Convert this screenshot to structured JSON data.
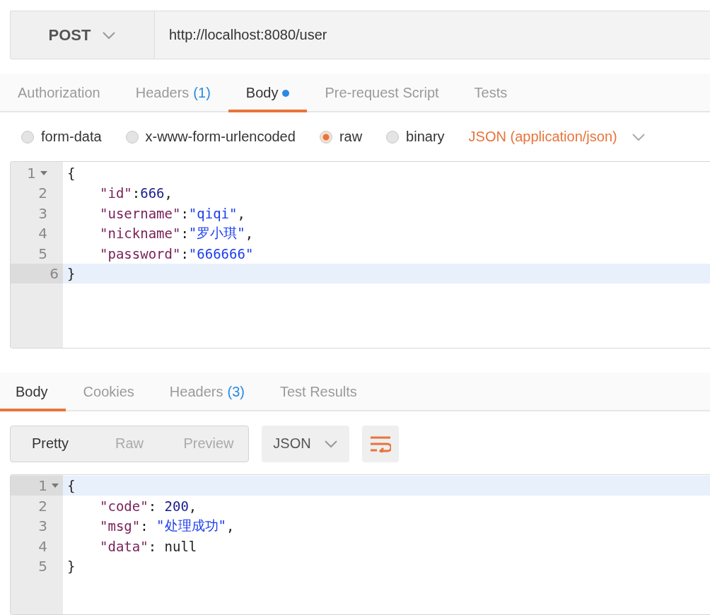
{
  "request": {
    "method": "POST",
    "url": "http://localhost:8080/user"
  },
  "request_tabs": [
    {
      "label": "Authorization",
      "selected": false,
      "dot": false
    },
    {
      "label": "Headers",
      "count": "(1)",
      "selected": false,
      "dot": false
    },
    {
      "label": "Body",
      "selected": true,
      "dot": true
    },
    {
      "label": "Pre-request Script",
      "selected": false,
      "dot": false
    },
    {
      "label": "Tests",
      "selected": false,
      "dot": false
    }
  ],
  "body_types": [
    {
      "label": "form-data",
      "selected": false
    },
    {
      "label": "x-www-form-urlencoded",
      "selected": false
    },
    {
      "label": "raw",
      "selected": true
    },
    {
      "label": "binary",
      "selected": false
    }
  ],
  "content_type": "JSON (application/json)",
  "request_body": [
    {
      "number": "1",
      "fold": true,
      "active": false,
      "indented": false,
      "tokens": [
        {
          "kind": "punct",
          "text": "{"
        }
      ]
    },
    {
      "number": "2",
      "fold": false,
      "active": false,
      "indented": true,
      "tokens": [
        {
          "kind": "key",
          "text": "\"id\""
        },
        {
          "kind": "punct",
          "text": ":"
        },
        {
          "kind": "num",
          "text": "666"
        },
        {
          "kind": "punct",
          "text": ","
        }
      ]
    },
    {
      "number": "3",
      "fold": false,
      "active": false,
      "indented": true,
      "tokens": [
        {
          "kind": "key",
          "text": "\"username\""
        },
        {
          "kind": "punct",
          "text": ":"
        },
        {
          "kind": "str",
          "text": "\"qiqi\""
        },
        {
          "kind": "punct",
          "text": ","
        }
      ]
    },
    {
      "number": "4",
      "fold": false,
      "active": false,
      "indented": true,
      "tokens": [
        {
          "kind": "key",
          "text": "\"nickname\""
        },
        {
          "kind": "punct",
          "text": ":"
        },
        {
          "kind": "str",
          "text": "\"罗小琪\""
        },
        {
          "kind": "punct",
          "text": ","
        }
      ]
    },
    {
      "number": "5",
      "fold": false,
      "active": false,
      "indented": true,
      "tokens": [
        {
          "kind": "key",
          "text": "\"password\""
        },
        {
          "kind": "punct",
          "text": ":"
        },
        {
          "kind": "str",
          "text": "\"666666\""
        }
      ]
    },
    {
      "number": "6",
      "fold": false,
      "active": true,
      "indented": false,
      "tokens": [
        {
          "kind": "punct",
          "text": "}"
        }
      ]
    }
  ],
  "response_tabs": [
    {
      "label": "Body",
      "selected": true
    },
    {
      "label": "Cookies",
      "selected": false
    },
    {
      "label": "Headers",
      "count": "(3)",
      "selected": false
    },
    {
      "label": "Test Results",
      "selected": false
    }
  ],
  "view_modes": [
    {
      "label": "Pretty",
      "selected": true
    },
    {
      "label": "Raw",
      "selected": false
    },
    {
      "label": "Preview",
      "selected": false
    }
  ],
  "format": "JSON",
  "response_body": [
    {
      "number": "1",
      "fold": true,
      "active": true,
      "indented": false,
      "tokens": [
        {
          "kind": "punct",
          "text": "{"
        }
      ]
    },
    {
      "number": "2",
      "fold": false,
      "active": false,
      "indented": true,
      "tokens": [
        {
          "kind": "key",
          "text": "\"code\""
        },
        {
          "kind": "punct",
          "text": ": "
        },
        {
          "kind": "num",
          "text": "200"
        },
        {
          "kind": "punct",
          "text": ","
        }
      ]
    },
    {
      "number": "3",
      "fold": false,
      "active": false,
      "indented": true,
      "tokens": [
        {
          "kind": "key",
          "text": "\"msg\""
        },
        {
          "kind": "punct",
          "text": ": "
        },
        {
          "kind": "str",
          "text": "\"处理成功\""
        },
        {
          "kind": "punct",
          "text": ","
        }
      ]
    },
    {
      "number": "4",
      "fold": false,
      "active": false,
      "indented": true,
      "tokens": [
        {
          "kind": "key",
          "text": "\"data\""
        },
        {
          "kind": "punct",
          "text": ": "
        },
        {
          "kind": "plain",
          "text": "null"
        }
      ]
    },
    {
      "number": "5",
      "fold": false,
      "active": false,
      "indented": false,
      "tokens": [
        {
          "kind": "punct",
          "text": "}"
        }
      ]
    }
  ]
}
